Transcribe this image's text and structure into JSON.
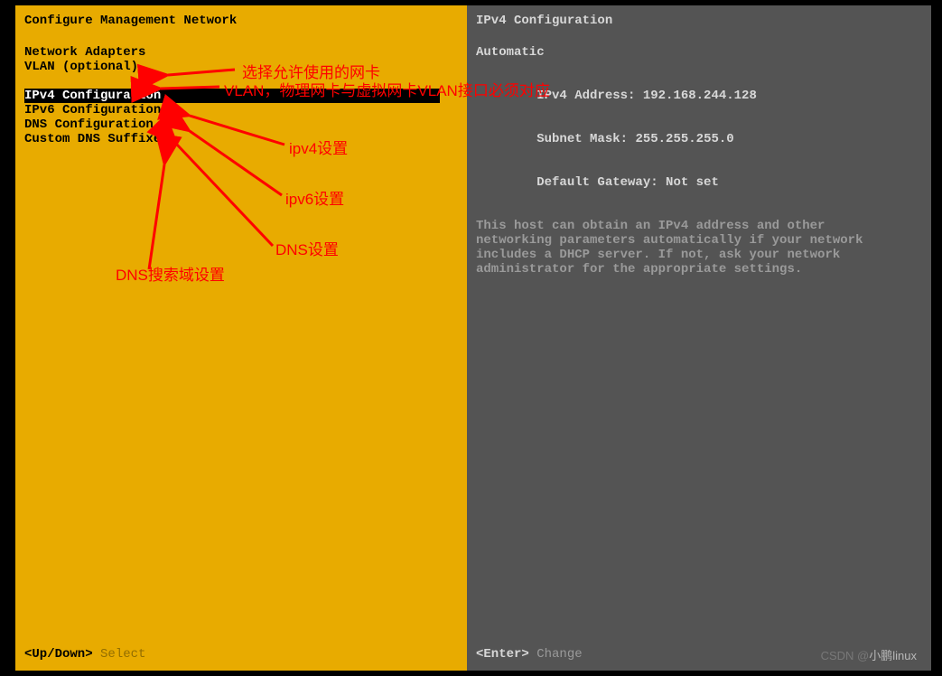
{
  "left": {
    "title": "Configure Management Network",
    "menu": {
      "network_adapters": "Network Adapters",
      "vlan_optional": "VLAN (optional)",
      "ipv4_config": "IPv4 Configuration",
      "ipv6_config": "IPv6 Configuration",
      "dns_config": "DNS Configuration",
      "custom_dns_suffixes": "Custom DNS Suffixes"
    },
    "footer": {
      "key": "<Up/Down>",
      "hint": "Select"
    }
  },
  "right": {
    "title": "IPv4 Configuration",
    "details": {
      "mode": "Automatic",
      "ipv4_label": "IPv4 Address:",
      "ipv4_address": "192.168.244.128",
      "subnet_label": "Subnet Mask:",
      "subnet_mask": "255.255.255.0",
      "gateway_label": "Default Gateway:",
      "gateway": "Not set"
    },
    "help": "This host can obtain an IPv4 address and other networking parameters automatically if your network includes a DHCP server. If not, ask your network administrator for the appropriate settings.",
    "footer": {
      "key": "<Enter>",
      "hint": "Change"
    }
  },
  "annotations": {
    "nic": "选择允许使用的网卡",
    "vlan": "VLAN，物理网卡与虚拟网卡VLAN接口必须对应",
    "ipv4": "ipv4设置",
    "ipv6": "ipv6设置",
    "dns": "DNS设置",
    "dns_suffix": "DNS搜索域设置"
  },
  "watermark": {
    "prefix": "CSDN ",
    "at": "@",
    "name": "小鹏linux"
  },
  "colors": {
    "left_bg": "#e8ab00",
    "right_bg": "#545454",
    "annotation": "#ff0000"
  }
}
